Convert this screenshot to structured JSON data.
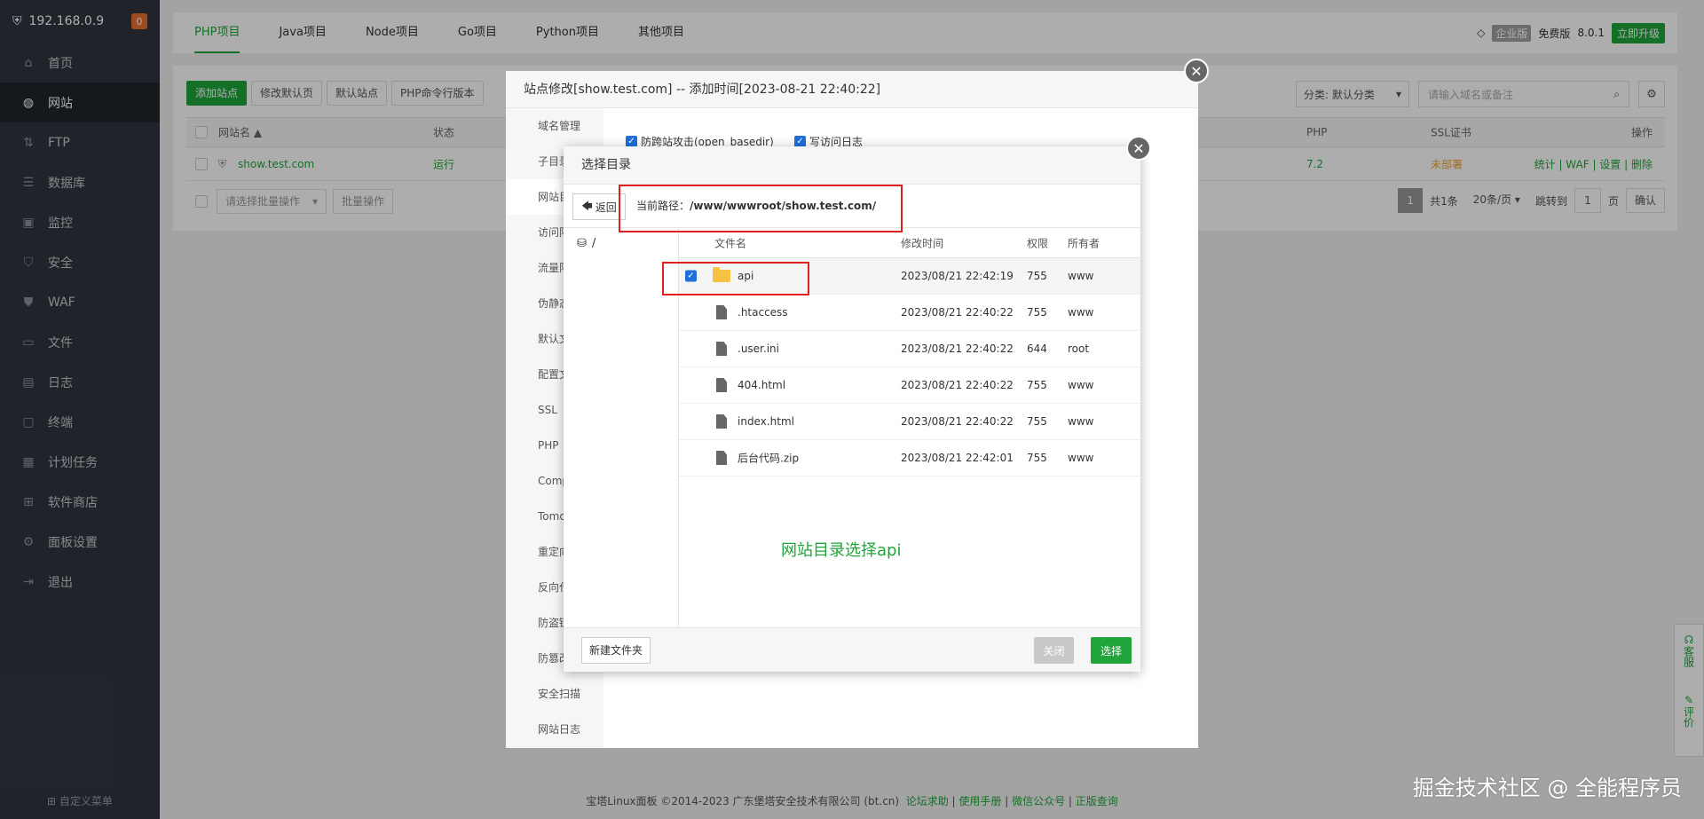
{
  "sidebar": {
    "host": "192.168.0.9",
    "badge": "0",
    "items": [
      {
        "label": "首页"
      },
      {
        "label": "网站"
      },
      {
        "label": "FTP"
      },
      {
        "label": "数据库"
      },
      {
        "label": "监控"
      },
      {
        "label": "安全"
      },
      {
        "label": "WAF"
      },
      {
        "label": "文件"
      },
      {
        "label": "日志"
      },
      {
        "label": "终端"
      },
      {
        "label": "计划任务"
      },
      {
        "label": "软件商店"
      },
      {
        "label": "面板设置"
      },
      {
        "label": "退出"
      }
    ],
    "custom_menu": "自定义菜单"
  },
  "topbar": {
    "tabs": [
      "PHP项目",
      "Java项目",
      "Node项目",
      "Go项目",
      "Python项目",
      "其他项目"
    ],
    "enterprise": "企业版",
    "free": "免费版",
    "version": "8.0.1",
    "upgrade": "立即升级"
  },
  "toolbar": {
    "add_site": "添加站点",
    "modify_default": "修改默认页",
    "default_site": "默认站点",
    "php_cli": "PHP命令行版本",
    "category": "分类: 默认分类",
    "search_placeholder": "请输入域名或备注"
  },
  "table": {
    "headers": {
      "name": "网站名 ▲",
      "status": "状态",
      "php": "PHP",
      "ssl": "SSL证书",
      "ops": "操作"
    },
    "row": {
      "name": "show.test.com",
      "status": "运行",
      "php": "7.2",
      "ssl": "未部署",
      "ops": [
        "统计",
        "WAF",
        "设置",
        "删除"
      ]
    },
    "batch_select": "请选择批量操作",
    "batch_btn": "批量操作",
    "pager": {
      "page": "1",
      "total": "共1条",
      "per_page": "20条/页",
      "goto": "跳转到",
      "goto_page": "1",
      "page_unit": "页",
      "confirm": "确认"
    }
  },
  "modal1": {
    "title": "站点修改[show.test.com] -- 添加时间[2023-08-21 22:40:22]",
    "tabs": [
      "域名管理",
      "子目录",
      "网站目",
      "访问限",
      "流量限",
      "伪静态",
      "默认文",
      "配置文",
      "SSL",
      "PHP",
      "Comp",
      "Tomc",
      "重定向",
      "反向代",
      "防盗链",
      "防篡改",
      "安全扫描",
      "网站日志"
    ],
    "check1": "防跨站攻击(open_basedir)",
    "check2": "写访问日志"
  },
  "modal2": {
    "title": "选择目录",
    "back": "返回",
    "path_label": "当前路径：",
    "path_value": "/www/wwwroot/show.test.com/",
    "tree_root": "/",
    "headers": {
      "name": "文件名",
      "mtime": "修改时间",
      "perm": "权限",
      "owner": "所有者"
    },
    "files": [
      {
        "name": "api",
        "mtime": "2023/08/21 22:42:19",
        "perm": "755",
        "owner": "www"
      },
      {
        "name": ".htaccess",
        "mtime": "2023/08/21 22:40:22",
        "perm": "755",
        "owner": "www"
      },
      {
        "name": ".user.ini",
        "mtime": "2023/08/21 22:40:22",
        "perm": "644",
        "owner": "root"
      },
      {
        "name": "404.html",
        "mtime": "2023/08/21 22:40:22",
        "perm": "755",
        "owner": "www"
      },
      {
        "name": "index.html",
        "mtime": "2023/08/21 22:40:22",
        "perm": "755",
        "owner": "www"
      },
      {
        "name": "后台代码.zip",
        "mtime": "2023/08/21 22:42:01",
        "perm": "755",
        "owner": "www"
      }
    ],
    "hint": "网站目录选择api",
    "new_folder": "新建文件夹",
    "close": "关闭",
    "select": "选择"
  },
  "footer": {
    "copyright": "宝塔Linux面板 ©2014-2023 广东堡塔安全技术有限公司 (bt.cn)",
    "links": [
      "论坛求助",
      "使用手册",
      "微信公众号",
      "正版查询"
    ],
    "watermark": "掘金技术社区 @ 全能程序员"
  },
  "float": {
    "service": "客服",
    "review": "评价"
  }
}
